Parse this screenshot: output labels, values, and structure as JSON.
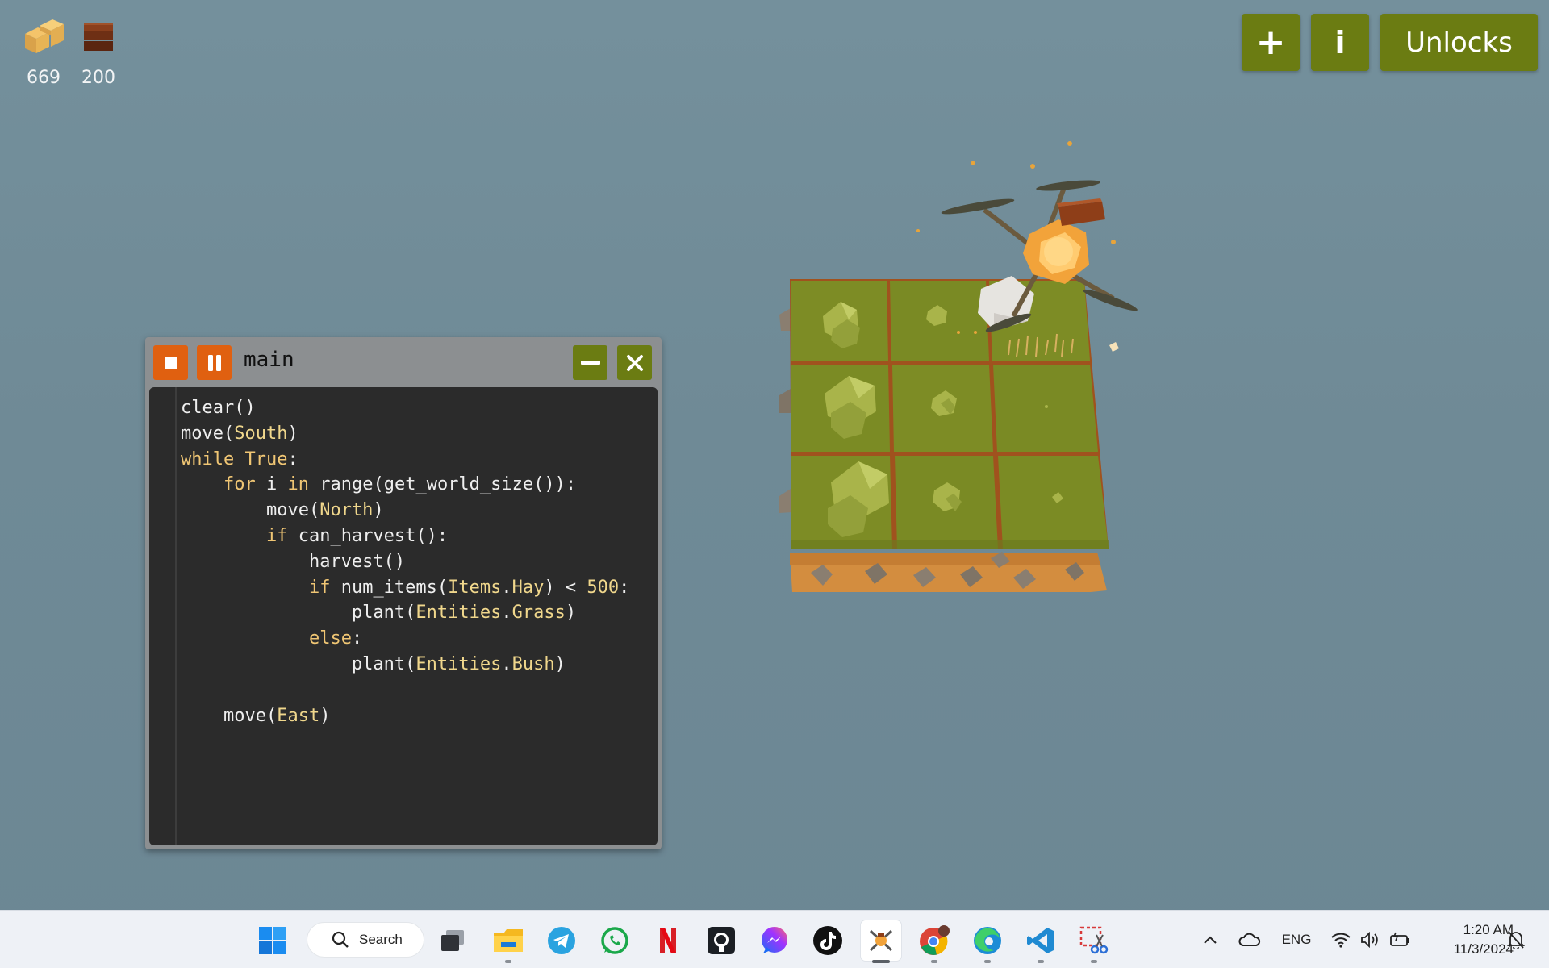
{
  "resources": [
    {
      "name": "hay",
      "icon": "hay-icon",
      "count": "669"
    },
    {
      "name": "wood",
      "icon": "wood-icon",
      "count": "200"
    }
  ],
  "hud_buttons": {
    "add_label": "+",
    "info_label": "i",
    "unlocks_label": "Unlocks"
  },
  "code_window": {
    "title": "main",
    "lines": [
      "clear()",
      "move(South)",
      "while True:",
      "    for i in range(get_world_size()):",
      "        move(North)",
      "        if can_harvest():",
      "            harvest()",
      "            if num_items(Items.Hay) < 500:",
      "                plant(Entities.Grass)",
      "            else:",
      "                plant(Entities.Bush)",
      "",
      "    move(East)"
    ]
  },
  "colors": {
    "accent_green": "#6b7c12",
    "accent_orange": "#e06010",
    "sky": "#74909c",
    "grass": "#7a8a24",
    "soil": "#d08a3c"
  },
  "taskbar": {
    "search_label": "Search",
    "apps": [
      "windows-start-icon",
      "task-view-icon",
      "file-explorer-icon",
      "telegram-icon",
      "whatsapp-icon",
      "netflix-icon",
      "github-icon",
      "messenger-icon",
      "tiktok-icon",
      "farmer-game-icon",
      "chrome-icon",
      "edge-icon",
      "vscode-icon",
      "snipping-tool-icon"
    ],
    "language": "ENG",
    "time": "1:20 AM",
    "date": "11/3/2024"
  }
}
